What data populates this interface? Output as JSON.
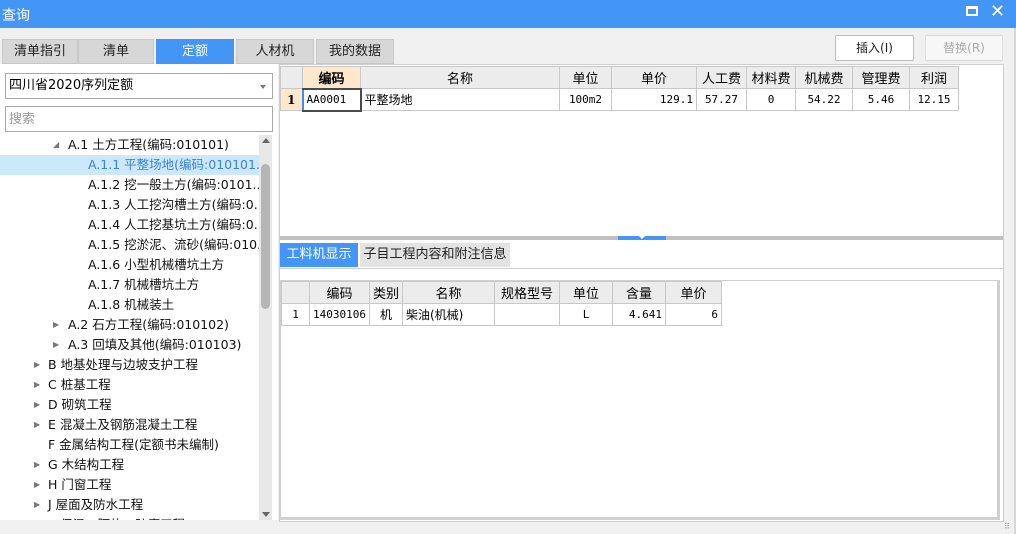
{
  "window": {
    "title": "查询",
    "maximize_icon": "maximize-icon",
    "close_icon": "close-icon"
  },
  "tabs": [
    {
      "label": "清单指引",
      "active": false
    },
    {
      "label": "清单",
      "active": false
    },
    {
      "label": "定额",
      "active": true
    },
    {
      "label": "人材机",
      "active": false
    },
    {
      "label": "我的数据",
      "active": false
    }
  ],
  "buttons": {
    "insert": "插入(I)",
    "replace": "替换(R)"
  },
  "left": {
    "library_select": "四川省2020序列定额",
    "search_placeholder": "搜索",
    "tree": [
      {
        "label": "A.1 土方工程(编码:010101)",
        "level": 1,
        "arrow": "expanded",
        "selected": false
      },
      {
        "label": "A.1.1 平整场地(编码:010101...",
        "level": 2,
        "arrow": "none",
        "selected": true
      },
      {
        "label": "A.1.2 挖一般土方(编码:0101...",
        "level": 2,
        "arrow": "none",
        "selected": false
      },
      {
        "label": "A.1.3 人工挖沟槽土方(编码:0...",
        "level": 2,
        "arrow": "none",
        "selected": false
      },
      {
        "label": "A.1.4 人工挖基坑土方(编码:0...",
        "level": 2,
        "arrow": "none",
        "selected": false
      },
      {
        "label": "A.1.5 挖淤泥、流砂(编码:010...",
        "level": 2,
        "arrow": "none",
        "selected": false
      },
      {
        "label": "A.1.6 小型机械槽坑土方",
        "level": 2,
        "arrow": "none",
        "selected": false
      },
      {
        "label": "A.1.7 机械槽坑土方",
        "level": 2,
        "arrow": "none",
        "selected": false
      },
      {
        "label": "A.1.8 机械装土",
        "level": 2,
        "arrow": "none",
        "selected": false
      },
      {
        "label": "A.2 石方工程(编码:010102)",
        "level": 1,
        "arrow": "collapsed",
        "selected": false
      },
      {
        "label": "A.3 回填及其他(编码:010103)",
        "level": 1,
        "arrow": "collapsed",
        "selected": false
      },
      {
        "label": "B 地基处理与边坡支护工程",
        "level": 0,
        "arrow": "collapsed",
        "selected": false
      },
      {
        "label": "C 桩基工程",
        "level": 0,
        "arrow": "collapsed",
        "selected": false
      },
      {
        "label": "D 砌筑工程",
        "level": 0,
        "arrow": "collapsed",
        "selected": false
      },
      {
        "label": "E 混凝土及钢筋混凝土工程",
        "level": 0,
        "arrow": "collapsed",
        "selected": false
      },
      {
        "label": "F 金属结构工程(定额书未编制)",
        "level": 0,
        "arrow": "none",
        "selected": false
      },
      {
        "label": "G 木结构工程",
        "level": 0,
        "arrow": "collapsed",
        "selected": false
      },
      {
        "label": "H 门窗工程",
        "level": 0,
        "arrow": "collapsed",
        "selected": false
      },
      {
        "label": "J 屋面及防水工程",
        "level": 0,
        "arrow": "collapsed",
        "selected": false
      },
      {
        "label": "K 保温、隔热、防腐工程",
        "level": 0,
        "arrow": "collapsed",
        "selected": false
      }
    ]
  },
  "quota_table": {
    "columns": [
      "",
      "编码",
      "名称",
      "单位",
      "单价",
      "人工费",
      "材料费",
      "机械费",
      "管理费",
      "利润"
    ],
    "rows": [
      {
        "num": "1",
        "code": "AA0001",
        "name": "平整场地",
        "unit": "100m2",
        "price": "129.1",
        "labor": "57.27",
        "material": "0",
        "machine": "54.22",
        "mgmt": "5.46",
        "profit": "12.15"
      }
    ]
  },
  "sub_tabs": [
    {
      "label": "工料机显示",
      "active": true
    },
    {
      "label": "子目工程内容和附注信息",
      "active": false
    }
  ],
  "resource_table": {
    "columns": [
      "",
      "编码",
      "类别",
      "名称",
      "规格型号",
      "单位",
      "含量",
      "单价"
    ],
    "rows": [
      {
        "num": "1",
        "code": "14030106",
        "type": "机",
        "name": "柴油(机械)",
        "spec": "",
        "unit": "L",
        "qty": "4.641",
        "price": "6"
      }
    ]
  }
}
